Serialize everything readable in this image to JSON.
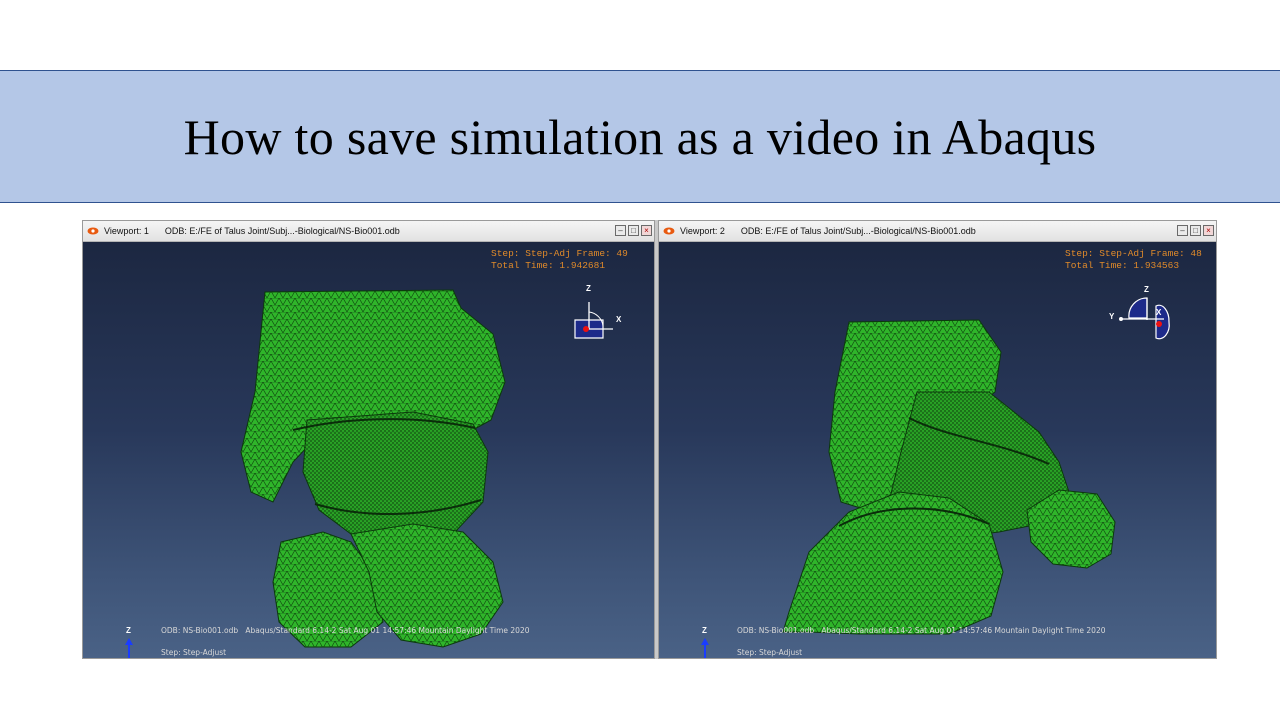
{
  "slide": {
    "title": "How to save simulation as a video in Abaqus"
  },
  "viewports": [
    {
      "label": "Viewport: 1",
      "odb_path": "ODB: E:/FE of Talus Joint/Subj...-Biological/NS-Bio001.odb",
      "step_line": "Step: Step-Adj Frame: 49",
      "time_line": "Total Time: 1.942681",
      "triad": {
        "up": "Z",
        "right": "X",
        "left": ""
      },
      "footer_odb": "ODB: NS-Bio001.odb",
      "footer_info": "Abaqus/Standard 6.14-2   Sat Aug 01 14:57:46 Mountain Daylight Time 2020",
      "footer_step": "Step: Step-Adjust",
      "corner_axis": "Z"
    },
    {
      "label": "Viewport: 2",
      "odb_path": "ODB: E:/FE of Talus Joint/Subj...-Biological/NS-Bio001.odb",
      "step_line": "Step: Step-Adj Frame: 48",
      "time_line": "Total Time: 1.934563",
      "triad": {
        "up": "Z",
        "right": "X",
        "left": "Y"
      },
      "footer_odb": "ODB: NS-Bio001.odb",
      "footer_info": "Abaqus/Standard 6.14-2   Sat Aug 01 14:57:46 Mountain Daylight Time 2020",
      "footer_step": "Step: Step-Adjust",
      "corner_axis": "Z"
    }
  ],
  "colors": {
    "title_band": "#b4c7e7",
    "mesh_fill": "#2fb52a",
    "hud_text": "#e08a2a",
    "viewport_bg": "#28385a"
  }
}
